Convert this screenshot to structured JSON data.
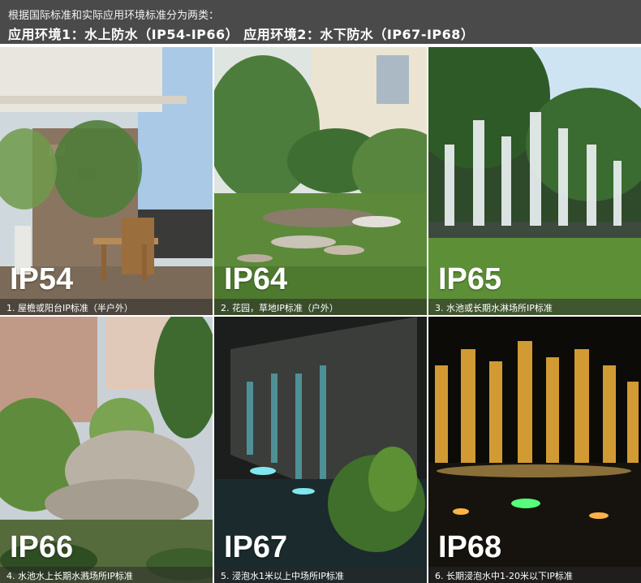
{
  "header": {
    "line1": "根据国际标准和实际应用环境标准分为两类：",
    "line2": "应用环境1：水上防水（IP54-IP66）  应用环境2：水下防水（IP67-IP68）"
  },
  "tiles": [
    {
      "code": "IP54",
      "caption": "1. 屋檐或阳台IP标准（半户外）"
    },
    {
      "code": "IP64",
      "caption": "2. 花园，草地IP标准（户外）"
    },
    {
      "code": "IP65",
      "caption": "3. 水池或长期水淋场所IP标准"
    },
    {
      "code": "IP66",
      "caption": "4. 水池水上长期水溅场所IP标准"
    },
    {
      "code": "IP67",
      "caption": "5. 浸泡水1米以上中场所IP标准"
    },
    {
      "code": "IP68",
      "caption": "6. 长期浸泡水中1-20米以下IP标准"
    }
  ],
  "colors": {
    "header_bg": "#4a4a4a",
    "text": "#ffffff"
  }
}
